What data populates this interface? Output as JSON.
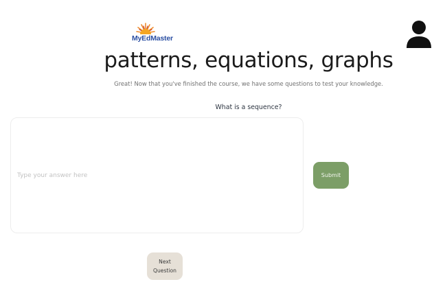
{
  "brand": {
    "logo_text": "MyEdMaster",
    "colors": {
      "sun": "#ef8a2b",
      "text": "#2b4fa3"
    }
  },
  "header": {
    "title": "patterns, equations, graphs",
    "subtitle": "Great! Now that you've finished the course, we have some questions to test your knowledge.",
    "avatar_icon": "user-icon"
  },
  "quiz": {
    "question": "What is a sequence?",
    "answer_placeholder": "Type your answer here",
    "answer_value": "",
    "submit_label": "Submit",
    "next_label": "Next Question"
  },
  "colors": {
    "submit_bg": "#7c9e67",
    "next_bg": "#e6e0d7",
    "title": "#1b1b1b"
  }
}
